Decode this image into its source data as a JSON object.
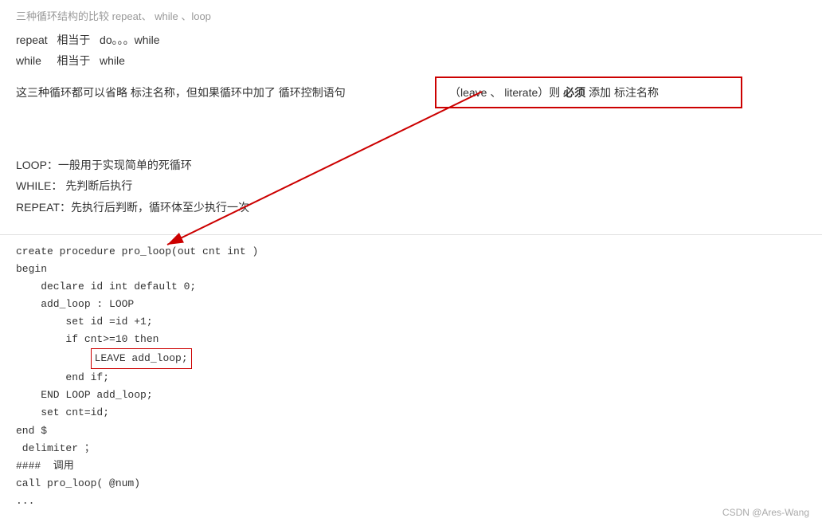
{
  "top": {
    "header": "三种循环结构的比较  repeat、 while 、loop",
    "rows": [
      {
        "left": "repeat",
        "middle": "相当于",
        "right": "do。。。while"
      },
      {
        "left": "while",
        "middle": "相当于",
        "right": "while"
      }
    ],
    "notice": "这三种循环都可以省略 标注名称，但如果循环中加了 循环控制语句",
    "highlight": "（leave 、 literate）则  必须  添加 标注名称",
    "highlight_bold": "必须",
    "descriptions": [
      "LOOP：一般用于实现简单的死循环",
      "WHILE：  先判断后执行",
      "REPEAT：先执行后判断，循环体至少执行一次"
    ]
  },
  "code": {
    "lines": [
      "create procedure pro_loop(out cnt int )",
      "begin",
      "    declare id int default 0;",
      "    add_loop : LOOP",
      "        set id =id +1;",
      "        if cnt>=10 then",
      "            LEAVE add_loop;",
      "        end if;",
      "    END LOOP add_loop;",
      "    set cnt=id;",
      "end $",
      " delimiter ；",
      "####  调用",
      "call pro_loop( @num)",
      "..."
    ],
    "highlighted_line_index": 6,
    "highlighted_text": "            LEAVE add_loop;"
  },
  "watermark": "CSDN @Ares-Wang"
}
